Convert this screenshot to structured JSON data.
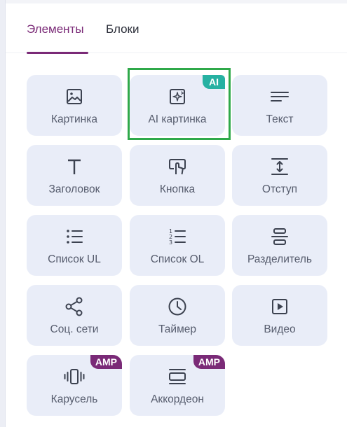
{
  "tabs": [
    {
      "label": "Элементы",
      "active": true
    },
    {
      "label": "Блоки",
      "active": false
    }
  ],
  "colors": {
    "accent": "#7a2a77",
    "tile_bg": "#e9edf8",
    "ai_badge": "#26b1a2",
    "amp_badge": "#7a2a77",
    "highlight": "#2fa94a"
  },
  "elements": [
    {
      "label": "Картинка",
      "icon": "image-icon"
    },
    {
      "label": "AI картинка",
      "icon": "ai-image-icon",
      "badge": "AI",
      "selected": true
    },
    {
      "label": "Текст",
      "icon": "text-lines-icon"
    },
    {
      "label": "Заголовок",
      "icon": "heading-t-icon"
    },
    {
      "label": "Кнопка",
      "icon": "button-click-icon"
    },
    {
      "label": "Отступ",
      "icon": "spacer-icon"
    },
    {
      "label": "Список UL",
      "icon": "bullet-list-icon"
    },
    {
      "label": "Список OL",
      "icon": "numbered-list-icon"
    },
    {
      "label": "Разделитель",
      "icon": "divider-icon"
    },
    {
      "label": "Соц. сети",
      "icon": "share-icon"
    },
    {
      "label": "Таймер",
      "icon": "clock-icon"
    },
    {
      "label": "Видео",
      "icon": "video-play-icon"
    },
    {
      "label": "Карусель",
      "icon": "carousel-icon",
      "badge": "AMP"
    },
    {
      "label": "Аккордеон",
      "icon": "accordion-icon",
      "badge": "AMP"
    }
  ]
}
